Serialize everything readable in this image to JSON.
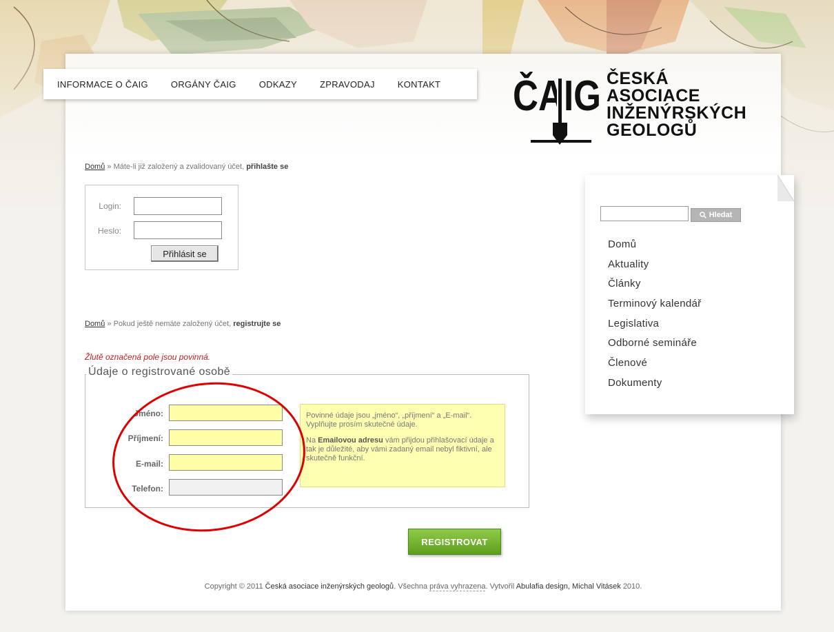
{
  "nav": {
    "items": [
      "INFORMACE O ČAIG",
      "ORGÁNY ČAIG",
      "ODKAZY",
      "ZPRAVODAJ",
      "KONTAKT"
    ]
  },
  "logo": {
    "mark": "ČAIG",
    "lines": [
      "ČESKÁ",
      "ASOCIACE",
      "INŽENÝRSKÝCH",
      "GEOLOGŮ"
    ]
  },
  "login_section": {
    "breadcrumb_home": "Domů",
    "breadcrumb_sep": "»",
    "breadcrumb_text": "Máte-li již založený a zvalidovaný účet,",
    "breadcrumb_bold": "přihlašte se",
    "login_label": "Login:",
    "password_label": "Heslo:",
    "login_value": "",
    "password_value": "",
    "submit_label": "Přihlásit se"
  },
  "register_section": {
    "breadcrumb_home": "Domů",
    "breadcrumb_sep": "»",
    "breadcrumb_text": "Pokud ještě nemáte založený účet,",
    "breadcrumb_bold": "registrujte se",
    "required_note": "Žlutě označená pole jsou povinná.",
    "legend": "Údaje o registrované osobě",
    "fields": [
      {
        "label": "Jméno:",
        "value": ""
      },
      {
        "label": "Příjmení:",
        "value": ""
      },
      {
        "label": "E-mail:",
        "value": ""
      },
      {
        "label": "Telefon:",
        "value": ""
      }
    ],
    "help_p1": "Povinné údaje jsou „jméno“, „příjmení“ a „E-mail“. Vyplňujte prosím skutečné údaje.",
    "help_p2_pre": "Na",
    "help_p2_bold": "Emailovou adresu",
    "help_p2_post": "vám přijdou přihlašovací údaje a tak je důležité, aby vámi zadaný email nebyl fiktivní, ale skutečně funkční.",
    "submit_label": "REGISTROVAT"
  },
  "sidebar": {
    "search_placeholder": "",
    "search_button": "Hledat",
    "items": [
      "Domů",
      "Aktuality",
      "Články",
      "Terminový kalendář",
      "Legislativa",
      "Odborné semináře",
      "Členové",
      "Dokumenty"
    ]
  },
  "footer": {
    "copyright": "Copyright © 2011",
    "org": "Česká asociace inženýrských geologů",
    "rights_pre": ". Všechna",
    "rights_link": "práva vyhrazena",
    "made_by_pre": ". Vytvořil",
    "made_by": "Abulafia design, Michal Vitásek",
    "year": "2010."
  },
  "colors": {
    "accent_green": "#6aac2a",
    "required_yellow": "#ffffa8",
    "annotation_red": "#dd0000"
  }
}
